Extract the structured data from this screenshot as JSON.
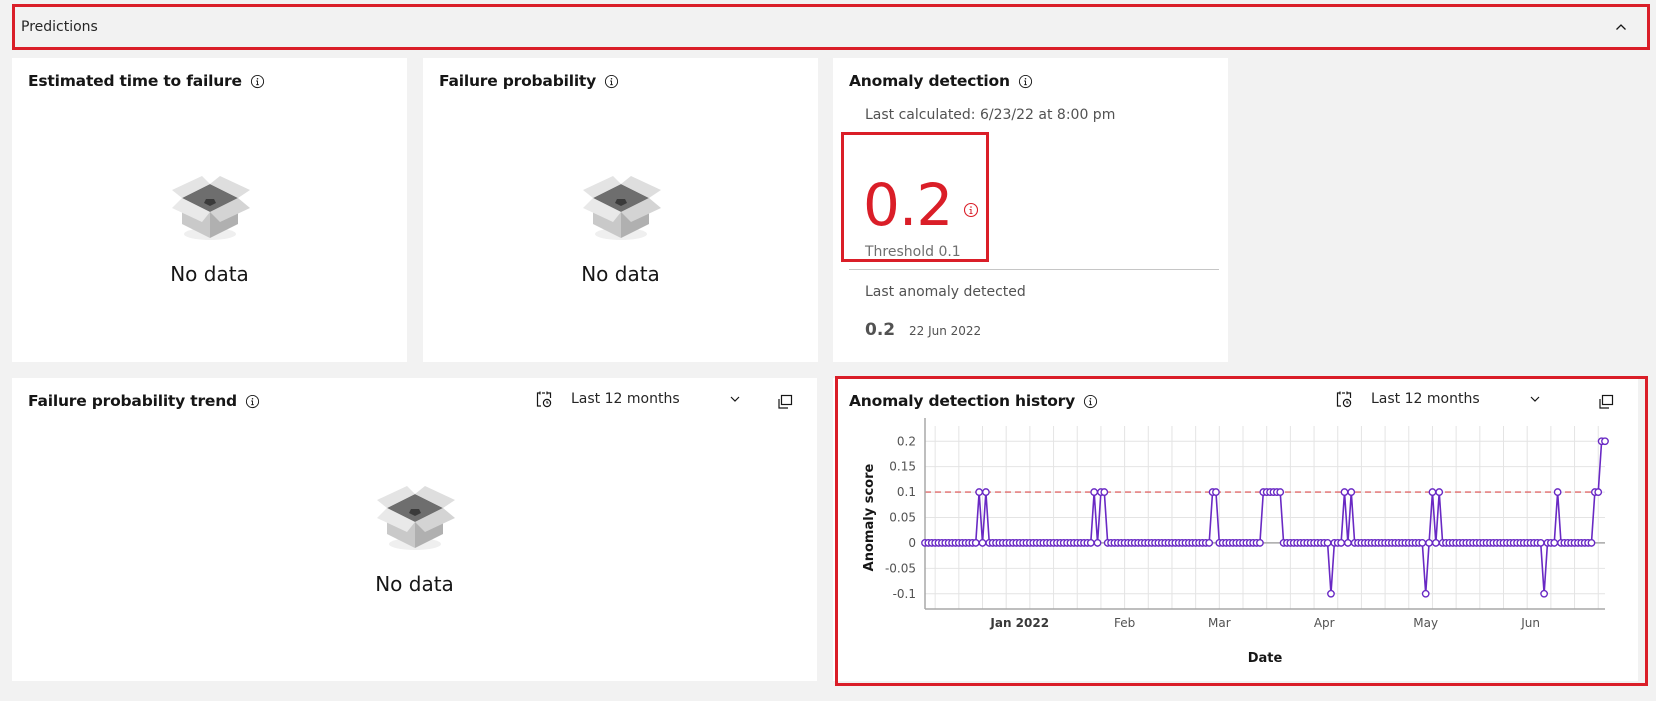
{
  "accordion": {
    "title": "Predictions",
    "expanded": true
  },
  "tiles": {
    "time_to_failure": {
      "title": "Estimated time to failure",
      "empty_message": "No data"
    },
    "failure_probability": {
      "title": "Failure probability",
      "empty_message": "No data"
    },
    "anomaly_detection": {
      "title": "Anomaly detection",
      "last_calculated": "Last calculated: 6/23/22 at 8:00 pm",
      "score": "0.2",
      "threshold_label": "Threshold 0.1",
      "last_anomaly_label": "Last anomaly detected",
      "last_anomaly_value": "0.2",
      "last_anomaly_date": "22 Jun 2022",
      "alert_color": "#da1e28"
    },
    "failure_probability_trend": {
      "title": "Failure probability trend",
      "range": "Last 12 months",
      "empty_message": "No data"
    },
    "anomaly_detection_history": {
      "title": "Anomaly detection history",
      "range": "Last 12 months"
    }
  },
  "chart_data": {
    "type": "line",
    "title": "Anomaly detection history",
    "xlabel": "Date",
    "ylabel": "Anomaly score",
    "ylim": [
      -0.13,
      0.23
    ],
    "yticks": [
      0.2,
      0.15,
      0.1,
      0.05,
      0,
      -0.05,
      -0.1
    ],
    "ytick_labels": [
      "0.2",
      "0.15",
      "0.1",
      "0.05",
      "0",
      "-0.05",
      "-0.1"
    ],
    "xlim": [
      "2021-12-04",
      "2022-06-23"
    ],
    "xticks": [
      {
        "date": "2022-01-01",
        "label": "Jan 2022",
        "bold": true
      },
      {
        "date": "2022-02-01",
        "label": "Feb",
        "bold": false
      },
      {
        "date": "2022-03-01",
        "label": "Mar",
        "bold": false
      },
      {
        "date": "2022-04-01",
        "label": "Apr",
        "bold": false
      },
      {
        "date": "2022-05-01",
        "label": "May",
        "bold": false
      },
      {
        "date": "2022-06-01",
        "label": "Jun",
        "bold": false
      }
    ],
    "threshold": 0.1,
    "threshold_color": "#e06a6a",
    "series_color": "#6929c4",
    "grid": true,
    "series": [
      {
        "name": "Anomaly score",
        "start_date": "2021-12-04",
        "baseline": 0,
        "points_per_day": 1,
        "length": 202,
        "overrides": [
          {
            "day": 16,
            "value": 0.1
          },
          {
            "day": 17,
            "value": 0
          },
          {
            "day": 18,
            "value": 0.1
          },
          {
            "day": 19,
            "value": 0
          },
          {
            "day": 50,
            "value": 0.1
          },
          {
            "day": 51,
            "value": 0
          },
          {
            "day": 52,
            "value": 0.1
          },
          {
            "day": 53,
            "value": 0.1
          },
          {
            "day": 85,
            "value": 0.1
          },
          {
            "day": 86,
            "value": 0.1
          },
          {
            "day": 100,
            "value": 0.1
          },
          {
            "day": 101,
            "value": 0.1
          },
          {
            "day": 102,
            "value": 0.1
          },
          {
            "day": 103,
            "value": 0.1
          },
          {
            "day": 104,
            "value": 0.1
          },
          {
            "day": 105,
            "value": 0.1
          },
          {
            "day": 120,
            "value": -0.1
          },
          {
            "day": 124,
            "value": 0.1
          },
          {
            "day": 125,
            "value": 0
          },
          {
            "day": 126,
            "value": 0.1
          },
          {
            "day": 148,
            "value": -0.1
          },
          {
            "day": 150,
            "value": 0.1
          },
          {
            "day": 151,
            "value": 0
          },
          {
            "day": 152,
            "value": 0.1
          },
          {
            "day": 183,
            "value": -0.1
          },
          {
            "day": 187,
            "value": 0.1
          },
          {
            "day": 198,
            "value": 0.1
          },
          {
            "day": 199,
            "value": 0.1
          },
          {
            "day": 200,
            "value": 0.2
          },
          {
            "day": 201,
            "value": 0.2
          }
        ]
      }
    ]
  }
}
